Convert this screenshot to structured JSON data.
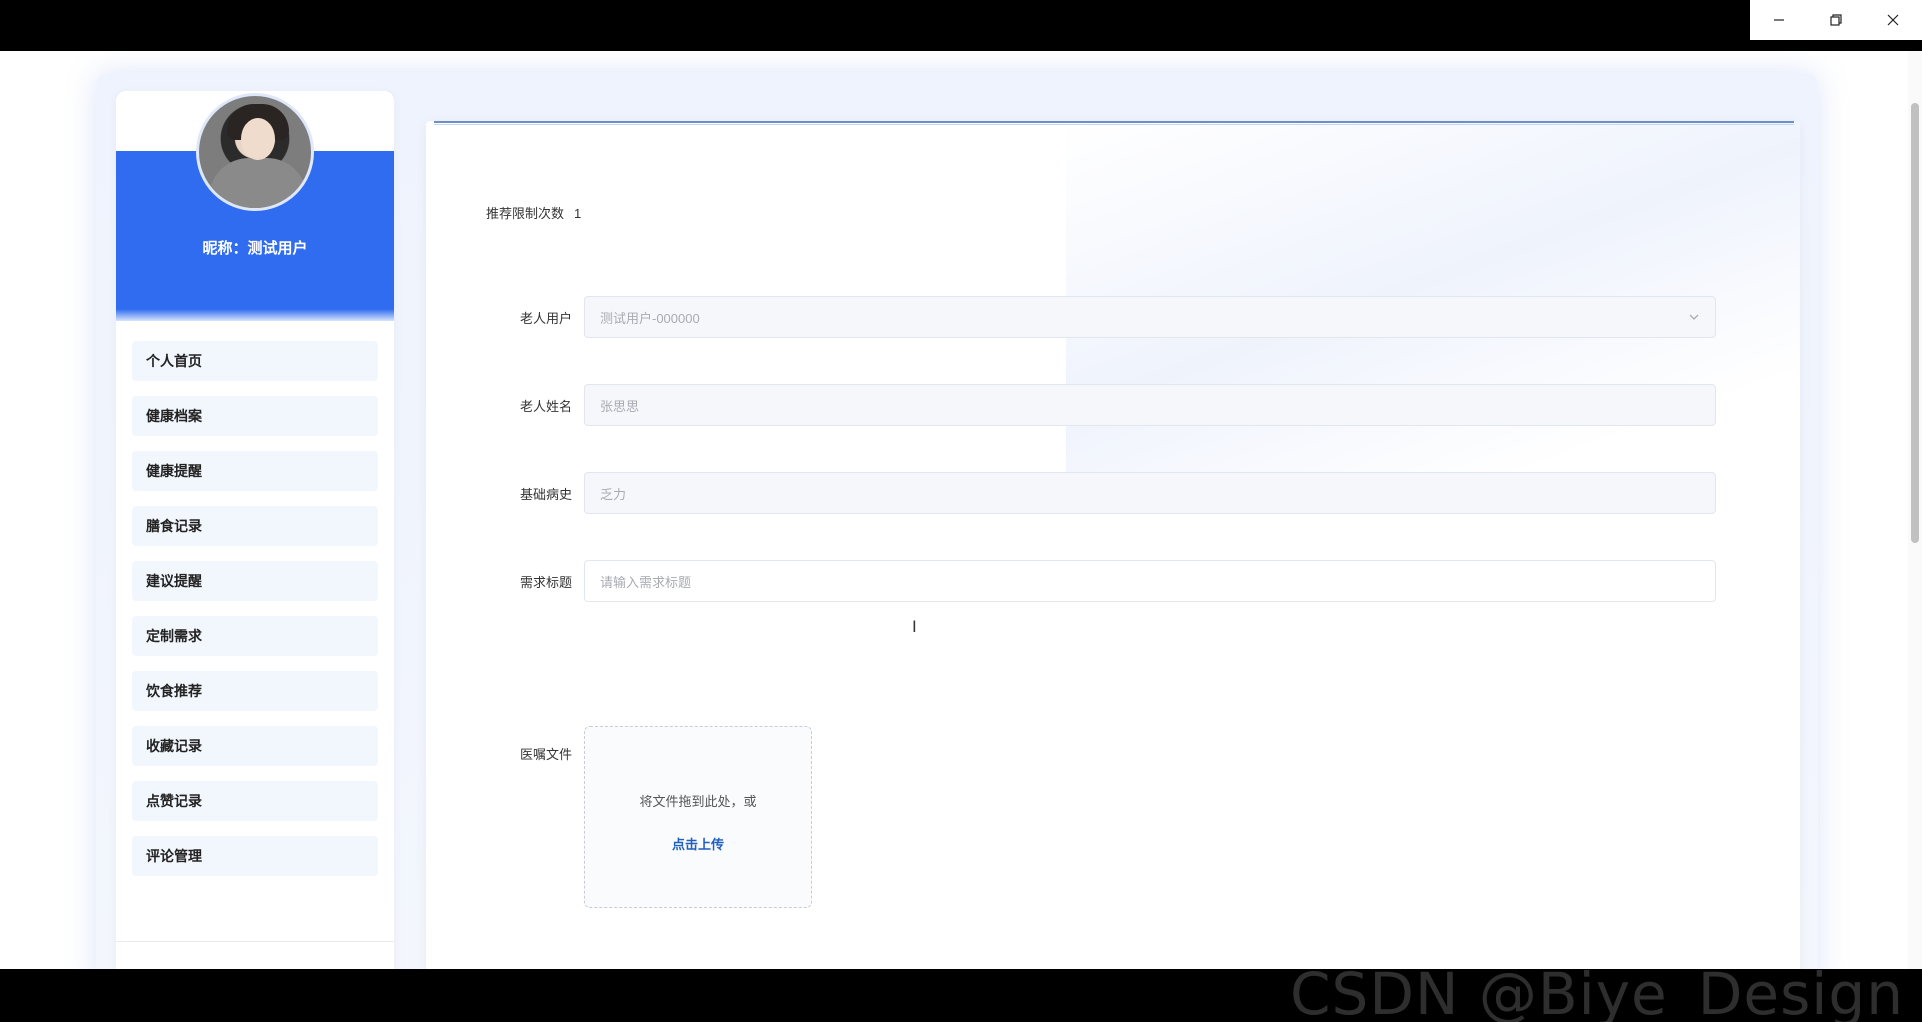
{
  "window": {
    "controls": {
      "minimize_icon": "minimize-icon",
      "restore_icon": "restore-icon",
      "close_icon": "close-icon"
    }
  },
  "profile": {
    "nickname": "昵称：测试用户",
    "avatar_icon": "user-avatar"
  },
  "sidebar": {
    "items": [
      {
        "label": "个人首页"
      },
      {
        "label": "健康档案"
      },
      {
        "label": "健康提醒"
      },
      {
        "label": "膳食记录"
      },
      {
        "label": "建议提醒"
      },
      {
        "label": "定制需求"
      },
      {
        "label": "饮食推荐"
      },
      {
        "label": "收藏记录"
      },
      {
        "label": "点赞记录"
      },
      {
        "label": "评论管理"
      }
    ]
  },
  "form": {
    "limit_label": "推荐限制次数",
    "limit_value": "1",
    "elderly_user": {
      "label": "老人用户",
      "value": "测试用户-000000"
    },
    "elderly_name": {
      "label": "老人姓名",
      "value": "张思思"
    },
    "medical_history": {
      "label": "基础病史",
      "value": "乏力"
    },
    "request_title": {
      "label": "需求标题",
      "placeholder": "请输入需求标题",
      "value": ""
    },
    "medical_file": {
      "label": "医嘱文件",
      "drag_text": "将文件拖到此处，或",
      "upload_link": "点击上传"
    }
  },
  "watermark": "CSDN @Biye_Design",
  "colors": {
    "accent": "#2f6cf0",
    "link": "#1f5fbf",
    "menu_bg": "#f2f6fd"
  }
}
